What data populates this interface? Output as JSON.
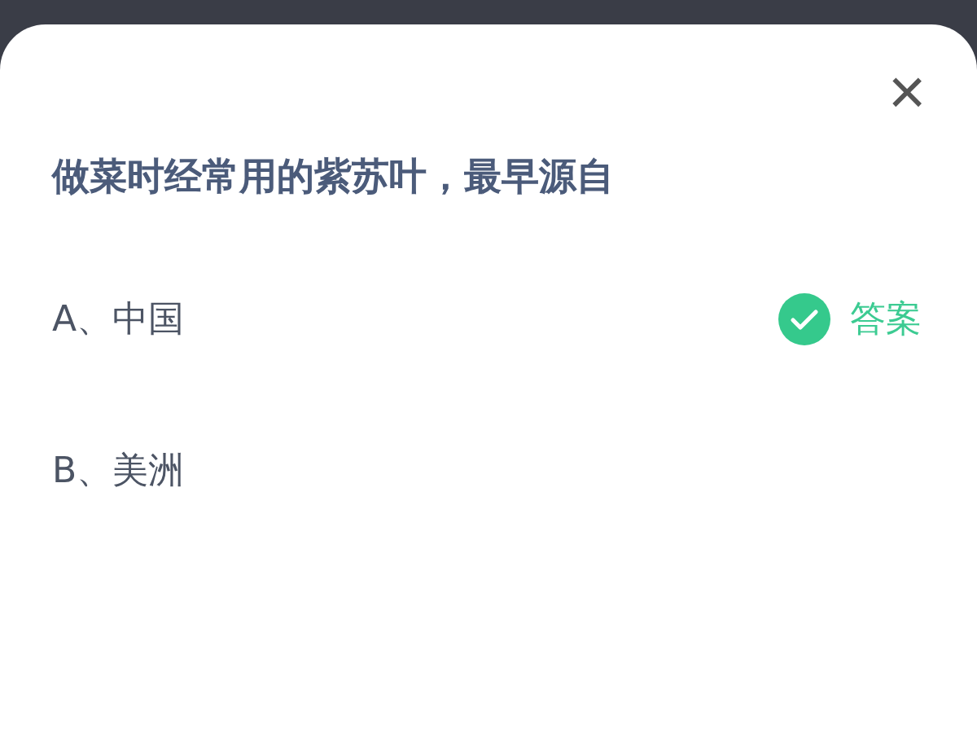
{
  "sheet": {
    "close": "×",
    "question": "做菜时经常用的紫苏叶，最早源自",
    "options": [
      {
        "label": "A、中国",
        "correct": true,
        "answer_label": "答案"
      },
      {
        "label": "B、美洲",
        "correct": false
      }
    ]
  }
}
